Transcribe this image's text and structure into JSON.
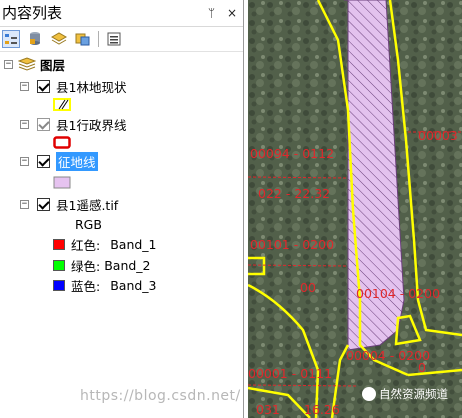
{
  "panel": {
    "title": "内容列表",
    "pin_glyph": "ᛘ",
    "close_glyph": "×"
  },
  "toolbar": {
    "icons": [
      "list-by-drawing-order-icon",
      "list-by-source-icon",
      "list-by-visibility-icon",
      "list-by-selection-icon",
      "options-icon"
    ]
  },
  "tree": {
    "root": {
      "label": "图层",
      "expander": "−"
    },
    "layers": [
      {
        "label": "县1林地现状",
        "expander": "−",
        "checked": true
      },
      {
        "label": "县1行政界线",
        "expander": "−",
        "checked": true
      },
      {
        "label": "征地线",
        "expander": "−",
        "checked": true,
        "selected": true
      },
      {
        "label": "县1遥感.tif",
        "expander": "−",
        "checked": true
      }
    ],
    "raster": {
      "composite": "RGB",
      "bands": [
        {
          "label": "红色:",
          "band": "Band_1",
          "color": "#ff0000"
        },
        {
          "label": "绿色:",
          "band": "Band_2",
          "color": "#00ff00"
        },
        {
          "label": "蓝色:",
          "band": "Band_3",
          "color": "#0000ff"
        }
      ]
    }
  },
  "colors": {
    "forest_outline": "#ffff00",
    "boundary_outline": "#e00000",
    "landuse_fill": "#e6c3f0",
    "label_red": "#e0282c"
  },
  "map": {
    "labels": [
      "00094 - 0112",
      "022 - 22.32",
      "00101 - 0200",
      "00",
      "00104 - 0200",
      "00004 - 0200",
      "00001 - 0111",
      "00003",
      "0",
      "031",
      "16.26"
    ]
  },
  "watermark": {
    "url": "https://blog.csdn.net/",
    "badge": "自然资源频道"
  }
}
